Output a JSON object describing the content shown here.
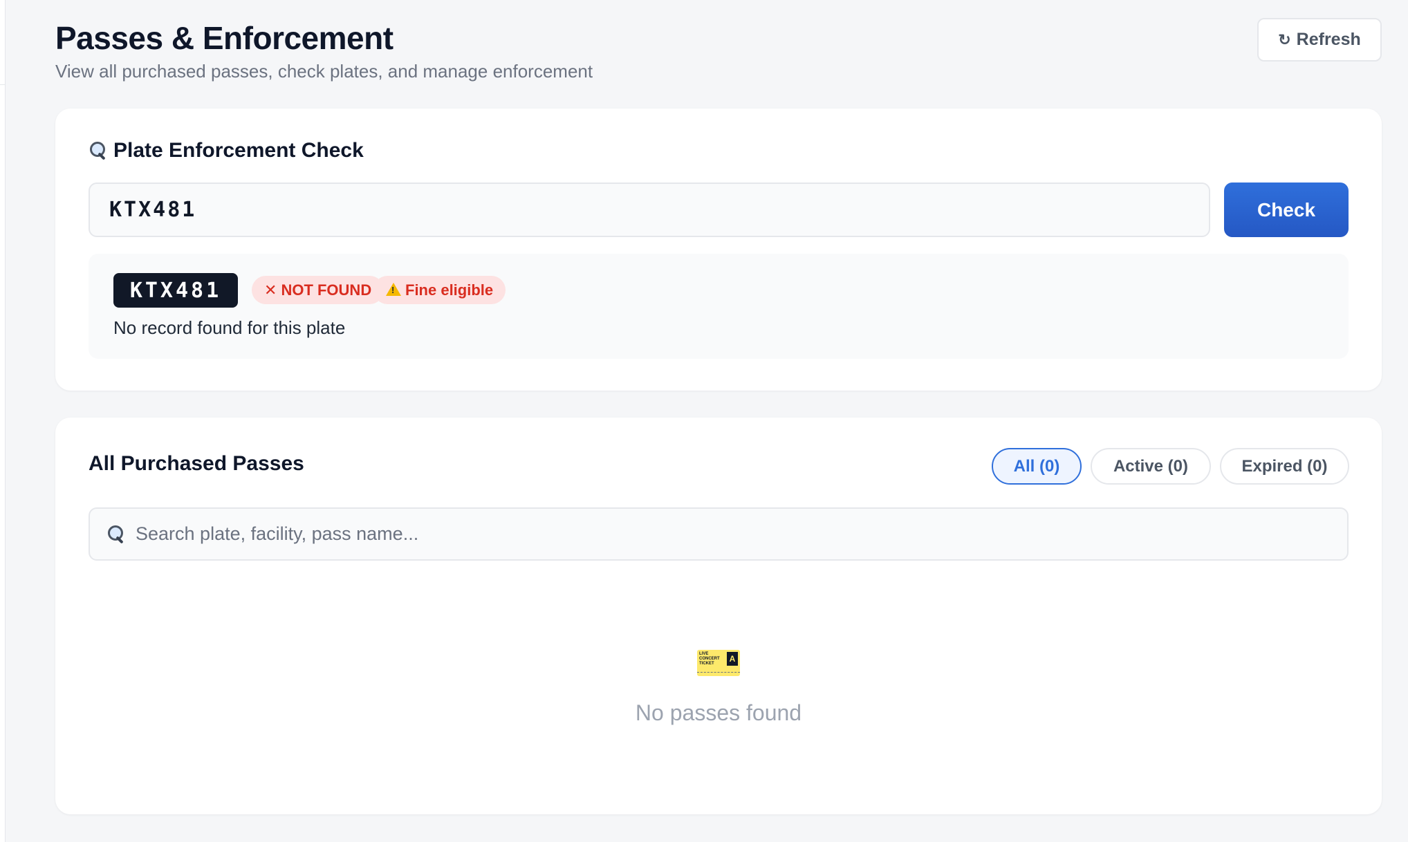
{
  "header": {
    "title": "Passes & Enforcement",
    "subtitle": "View all purchased passes, check plates, and manage enforcement",
    "refresh_icon": "↻",
    "refresh_label": "Refresh"
  },
  "enforcement": {
    "title": "Plate Enforcement Check",
    "title_icon": "magnifier-icon",
    "plate_value": "KTX481",
    "check_label": "Check",
    "result": {
      "plate": "KTX481",
      "status_icon": "✕",
      "status_label": "NOT FOUND",
      "fine_label": "Fine eligible",
      "fine_icon": "warning-icon",
      "message": "No record found for this plate",
      "status_color": "#d92d20"
    }
  },
  "passes": {
    "title": "All Purchased Passes",
    "filters": {
      "all": "All (0)",
      "active": "Active (0)",
      "expired": "Expired (0)"
    },
    "search_placeholder": "Search plate, facility, pass name...",
    "empty_icon": "ticket-icon",
    "empty_ticket_text": "LIVE CONCERT TICKET",
    "empty_ticket_zone": "A",
    "empty_text": "No passes found"
  },
  "colors": {
    "accent": "#2f6fdb",
    "danger": "#d92d20",
    "danger_bg": "#fde2e2",
    "background": "#f5f6f8"
  }
}
